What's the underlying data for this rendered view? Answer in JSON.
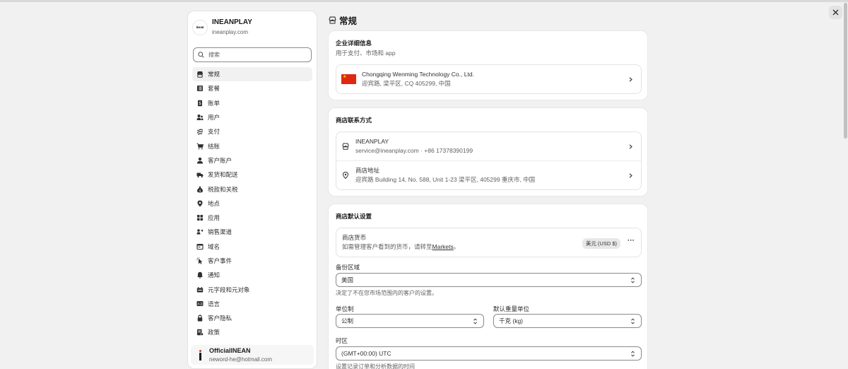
{
  "store": {
    "name": "INEANPLAY",
    "domain": "ineanplay.com",
    "logo_text": "inean"
  },
  "search": {
    "placeholder": "搜索"
  },
  "sidebar": {
    "items": [
      {
        "label": "常规",
        "icon": "store-icon",
        "active": true
      },
      {
        "label": "套餐",
        "icon": "plan-icon"
      },
      {
        "label": "账单",
        "icon": "billing-icon"
      },
      {
        "label": "用户",
        "icon": "users-icon"
      },
      {
        "label": "支付",
        "icon": "payments-icon"
      },
      {
        "label": "结账",
        "icon": "cart-icon"
      },
      {
        "label": "客户账户",
        "icon": "person-icon"
      },
      {
        "label": "发货和配送",
        "icon": "truck-icon"
      },
      {
        "label": "税款和关税",
        "icon": "tax-icon"
      },
      {
        "label": "地点",
        "icon": "location-icon"
      },
      {
        "label": "应用",
        "icon": "apps-icon"
      },
      {
        "label": "销售渠道",
        "icon": "channels-icon"
      },
      {
        "label": "域名",
        "icon": "globe-icon"
      },
      {
        "label": "客户事件",
        "icon": "cursor-icon"
      },
      {
        "label": "通知",
        "icon": "bell-icon"
      },
      {
        "label": "元字段和元对象",
        "icon": "metafields-icon"
      },
      {
        "label": "语言",
        "icon": "language-icon"
      },
      {
        "label": "客户隐私",
        "icon": "lock-icon"
      },
      {
        "label": "政策",
        "icon": "policy-icon"
      }
    ]
  },
  "user": {
    "name": "OfficialINEAN",
    "email": "neword-he@hotmail.com"
  },
  "page": {
    "title": "常规"
  },
  "business": {
    "title": "企业详细信息",
    "subtitle": "用于支付、市场和 app",
    "company": "Chongqing Wenming Technology Co., Ltd.",
    "address": "迎宾路, 梁平区, CQ 405299, 中国"
  },
  "contact": {
    "title": "商店联系方式",
    "store_name": "INEANPLAY",
    "store_contact": "service@ineanplay.com · +86 17378390199",
    "address_title": "商店地址",
    "address_value": "迎宾路 Building 14, No. 588, Unit 1-23 梁平区, 405299 重庆市, 中国"
  },
  "defaults": {
    "title": "商店默认设置",
    "currency_title": "商店货币",
    "currency_desc": "如需管理客户看到的货币，请转至",
    "currency_link": "Markets",
    "currency_period": "。",
    "currency_badge": "美元 (USD $)",
    "backup_region_label": "备份区域",
    "backup_region_value": "美国",
    "backup_region_help": "决定了不在您市场范围内的客户的设置。",
    "unit_label": "单位制",
    "unit_value": "公制",
    "weight_label": "默认重量单位",
    "weight_value": "千克 (kg)",
    "timezone_label": "时区",
    "timezone_value": "(GMT+00:00) UTC",
    "timezone_help": "设置记录订单和分析数据的时间"
  }
}
